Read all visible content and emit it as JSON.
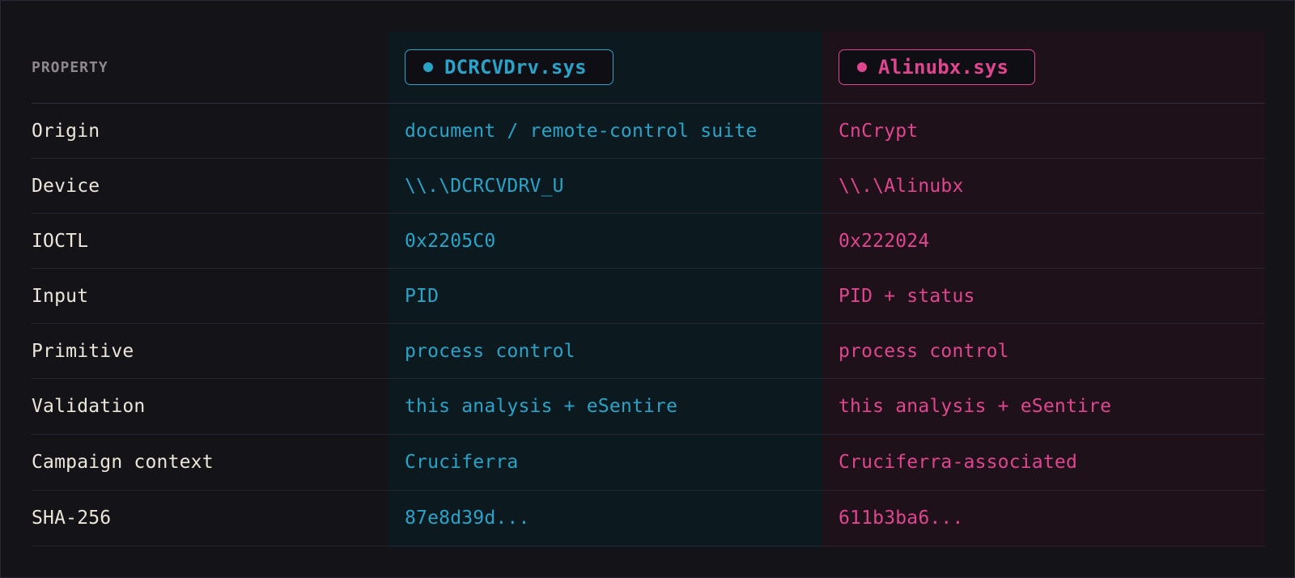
{
  "header": {
    "property_label": "PROPERTY",
    "driver_a": {
      "name": "DCRCVDrv.sys",
      "color": "#2aa3c8"
    },
    "driver_b": {
      "name": "Alinubx.sys",
      "color": "#e04690"
    }
  },
  "rows": [
    {
      "property": "Origin",
      "a": "document / remote-control suite",
      "b": "CnCrypt"
    },
    {
      "property": "Device",
      "a": "\\\\.\\DCRCVDRV_U",
      "b": "\\\\.\\Alinubx"
    },
    {
      "property": "IOCTL",
      "a": "0x2205C0",
      "b": "0x222024"
    },
    {
      "property": "Input",
      "a": "PID",
      "b": "PID + status"
    },
    {
      "property": "Primitive",
      "a": "process control",
      "b": "process control"
    },
    {
      "property": "Validation",
      "a": "this analysis + eSentire",
      "b": "this analysis + eSentire"
    },
    {
      "property": "Campaign context",
      "a": "Cruciferra",
      "b": "Cruciferra-associated"
    },
    {
      "property": "SHA-256",
      "a": "87e8d39d...",
      "b": "611b3ba6..."
    }
  ]
}
